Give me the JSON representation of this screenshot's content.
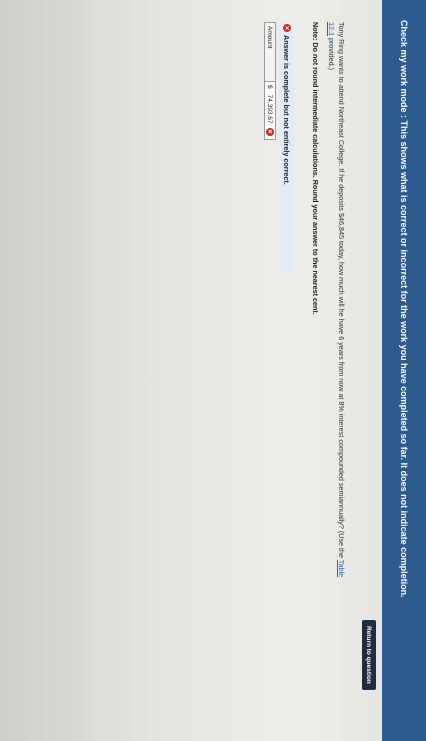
{
  "banner": {
    "text": "Check my work mode : This shows what is correct or incorrect for the work you have completed so far. It does not indicate completion."
  },
  "return_button": "Return to question",
  "question": {
    "part1": "Tony Ring wants to attend Northeast College. If he deposits $46,845 today, how much will he have 6 years from now at 8% interest compounded semiannually? (Use the ",
    "link": "Table 12.1",
    "part2": " provided.)"
  },
  "note": "Note: Do not round intermediate calculations. Round your answer to the nearest cent.",
  "answer": {
    "status": "Answer is complete but not entirely correct.",
    "label": "Amount",
    "currency": "$",
    "value": "74,393.67"
  },
  "colors": {
    "banner": "#2e5c8e",
    "incorrect": "#c8291f",
    "status_bg": "#e2ecf8"
  }
}
